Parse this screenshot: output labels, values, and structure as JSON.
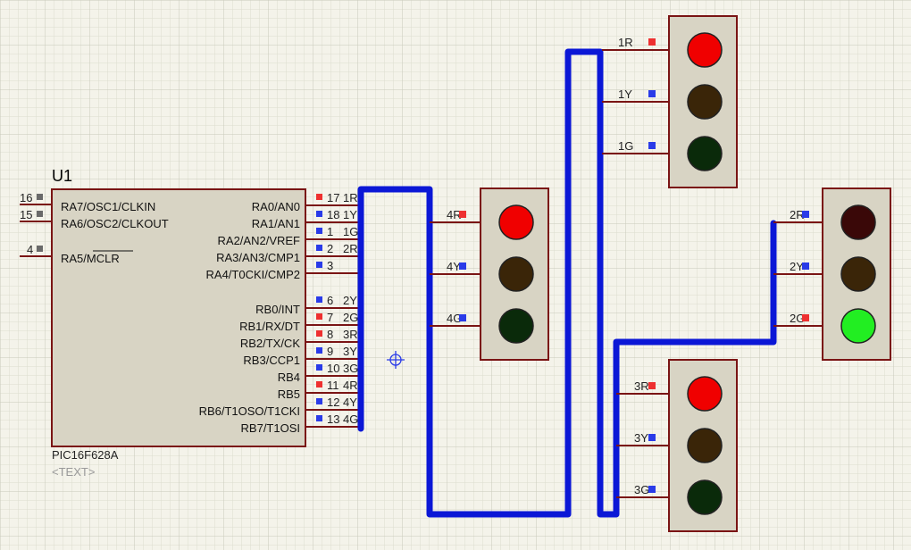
{
  "colors": {
    "grid_minor": "#dcdccf",
    "grid_major": "#c9c9bb",
    "body_fill": "#d8d4c4",
    "body_stroke": "#7a1414",
    "pin_wire": "#7a1414",
    "bus": "#0b17d6",
    "pin_red": "#ee3030",
    "pin_blue": "#2a3be8",
    "pin_gray": "#6a6a6a",
    "lamp_red_on": "#f00000",
    "lamp_red_off": "#3a0808",
    "lamp_yellow_off": "#3a2508",
    "lamp_green_off": "#0a2a0a",
    "lamp_green_on": "#22ee22"
  },
  "chip": {
    "ref": "U1",
    "part": "PIC16F628A",
    "text_placeholder": "<TEXT>",
    "left_pins": [
      {
        "num": "16",
        "label": "RA7/OSC1/CLKIN",
        "state": "gray"
      },
      {
        "num": "15",
        "label": "RA6/OSC2/CLKOUT",
        "state": "gray"
      },
      {
        "num": "4",
        "label": "RA5/MCLR",
        "state": "gray"
      }
    ],
    "right_pins": [
      {
        "num": "17",
        "label": "RA0/AN0",
        "net": "1R",
        "state": "red"
      },
      {
        "num": "18",
        "label": "RA1/AN1",
        "net": "1Y",
        "state": "blue"
      },
      {
        "num": "1",
        "label": "RA2/AN2/VREF",
        "net": "1G",
        "state": "blue"
      },
      {
        "num": "2",
        "label": "RA3/AN3/CMP1",
        "net": "2R",
        "state": "blue"
      },
      {
        "num": "3",
        "label": "RA4/T0CKI/CMP2",
        "net": "",
        "state": "blue"
      },
      {
        "num": "6",
        "label": "RB0/INT",
        "net": "2Y",
        "state": "blue"
      },
      {
        "num": "7",
        "label": "RB1/RX/DT",
        "net": "2G",
        "state": "red"
      },
      {
        "num": "8",
        "label": "RB2/TX/CK",
        "net": "3R",
        "state": "red"
      },
      {
        "num": "9",
        "label": "RB3/CCP1",
        "net": "3Y",
        "state": "blue"
      },
      {
        "num": "10",
        "label": "RB4",
        "net": "3G",
        "state": "blue"
      },
      {
        "num": "11",
        "label": "RB5",
        "net": "4R",
        "state": "red"
      },
      {
        "num": "12",
        "label": "RB6/T1OSO/T1CKI",
        "net": "4Y",
        "state": "blue"
      },
      {
        "num": "13",
        "label": "RB7/T1OSI",
        "net": "4G",
        "state": "blue"
      }
    ]
  },
  "traffic_lights": [
    {
      "id": "tl-1",
      "lamps": [
        {
          "label": "1R",
          "color": "red",
          "on": true,
          "state": "red"
        },
        {
          "label": "1Y",
          "color": "yellow",
          "on": false,
          "state": "blue"
        },
        {
          "label": "1G",
          "color": "green",
          "on": false,
          "state": "blue"
        }
      ]
    },
    {
      "id": "tl-2",
      "lamps": [
        {
          "label": "2R",
          "color": "red",
          "on": false,
          "state": "blue"
        },
        {
          "label": "2Y",
          "color": "yellow",
          "on": false,
          "state": "blue"
        },
        {
          "label": "2G",
          "color": "green",
          "on": true,
          "state": "red"
        }
      ]
    },
    {
      "id": "tl-3",
      "lamps": [
        {
          "label": "3R",
          "color": "red",
          "on": true,
          "state": "red"
        },
        {
          "label": "3Y",
          "color": "yellow",
          "on": false,
          "state": "blue"
        },
        {
          "label": "3G",
          "color": "green",
          "on": false,
          "state": "blue"
        }
      ]
    },
    {
      "id": "tl-4",
      "lamps": [
        {
          "label": "4R",
          "color": "red",
          "on": true,
          "state": "red"
        },
        {
          "label": "4Y",
          "color": "yellow",
          "on": false,
          "state": "blue"
        },
        {
          "label": "4G",
          "color": "green",
          "on": false,
          "state": "blue"
        }
      ]
    }
  ],
  "icons": {
    "crosshair": "crosshair-icon"
  }
}
